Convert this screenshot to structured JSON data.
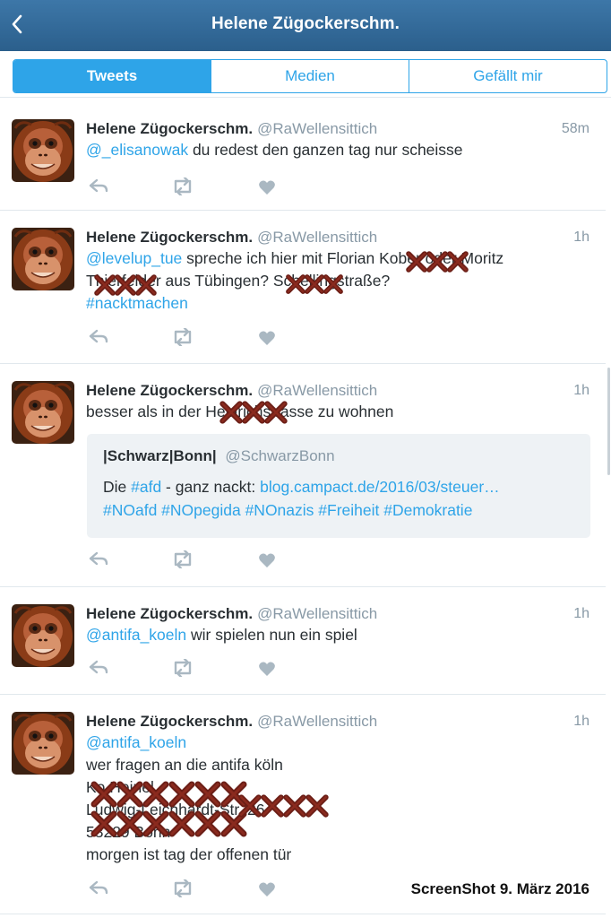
{
  "header": {
    "title": "Helene Zügockerschm."
  },
  "tabs": [
    "Tweets",
    "Medien",
    "Gefällt mir"
  ],
  "tweets": [
    {
      "name": "Helene Zügockerschm.",
      "handle": "@RaWellensittich",
      "time": "58m",
      "lines": [
        [
          {
            "t": "@_elisanowak",
            "link": true
          },
          {
            "t": " du redest den ganzen tag nur scheisse"
          }
        ]
      ]
    },
    {
      "name": "Helene Zügockerschm.",
      "handle": "@RaWellensittich",
      "time": "1h",
      "lines": [
        [
          {
            "t": "@levelup_tue",
            "link": true
          },
          {
            "t": " spreche ich hier mit Florian Kober oder Moritz"
          }
        ],
        [
          {
            "t": "Thierfelder aus Tübingen? Schellingstraße?"
          }
        ],
        [
          {
            "t": "#nacktmachen",
            "link": true
          }
        ]
      ]
    },
    {
      "name": "Helene Zügockerschm.",
      "handle": "@RaWellensittich",
      "time": "1h",
      "lines": [
        [
          {
            "t": "besser als in der Heinrichstrasse zu wohnen"
          }
        ]
      ],
      "quote": {
        "name": "|Schwarz|Bonn|",
        "handle": "@SchwarzBonn",
        "lines": [
          [
            {
              "t": "Die "
            },
            {
              "t": "#afd",
              "link": true
            },
            {
              "t": " - ganz nackt: "
            },
            {
              "t": "blog.campact.de/2016/03/steuer…",
              "link": true
            }
          ],
          [
            {
              "t": "#NOafd #NOpegida #NOnazis #Freiheit #Demokratie",
              "link": true
            }
          ]
        ]
      }
    },
    {
      "name": "Helene Zügockerschm.",
      "handle": "@RaWellensittich",
      "time": "1h",
      "lines": [
        [
          {
            "t": "@antifa_koeln",
            "link": true
          },
          {
            "t": " wir spielen nun ein spiel"
          }
        ]
      ]
    },
    {
      "name": "Helene Zügockerschm.",
      "handle": "@RaWellensittich",
      "time": "1h",
      "lines": [
        [
          {
            "t": "@antifa_koeln",
            "link": true
          }
        ],
        [
          {
            "t": "wer fragen an die antifa köln"
          }
        ],
        [
          {
            "t": "Ko Heinel"
          }
        ],
        [
          {
            "t": "Ludwig-Leichhardt-Str. 26"
          }
        ],
        [
          {
            "t": "53229 Bonn"
          }
        ],
        [
          {
            "t": "morgen ist tag der offenen tür"
          }
        ]
      ]
    }
  ],
  "footer": {
    "note": "ScreenShot 9. März 2016"
  },
  "colors": {
    "header": "#2e6393",
    "accent": "#2ea4e8",
    "muted": "#8899a6",
    "redaction": "#6b1e16"
  },
  "icons": [
    "chevron-left-icon",
    "reply-icon",
    "retweet-icon",
    "like-icon",
    "redaction-cross-icon"
  ]
}
